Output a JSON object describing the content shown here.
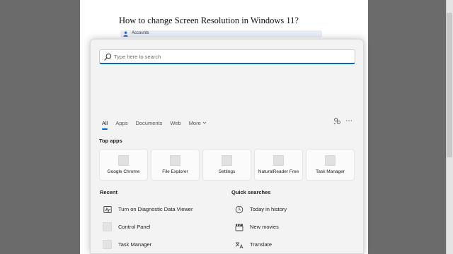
{
  "document": {
    "title": "How to change Screen Resolution in Windows 11?",
    "chip_label": "Accounts"
  },
  "search": {
    "placeholder": "Type here to search",
    "value": ""
  },
  "tabs": [
    {
      "label": "All",
      "active": true
    },
    {
      "label": "Apps"
    },
    {
      "label": "Documents"
    },
    {
      "label": "Web"
    },
    {
      "label": "More"
    }
  ],
  "header_icons": [
    "share-icon",
    "more-options-icon"
  ],
  "top_apps": {
    "title": "Top apps",
    "items": [
      {
        "label": "Google Chrome"
      },
      {
        "label": "File Explorer"
      },
      {
        "label": "Settings"
      },
      {
        "label": "NaturalReader Free"
      },
      {
        "label": "Task Manager"
      }
    ]
  },
  "recent": {
    "title": "Recent",
    "items": [
      {
        "label": "Turn on Diagnostic Data Viewer",
        "icon": "activity-chart-icon"
      },
      {
        "label": "Control Panel",
        "icon": "app-placeholder-icon"
      },
      {
        "label": "Task Manager",
        "icon": "app-placeholder-icon"
      }
    ]
  },
  "quick_searches": {
    "title": "Quick searches",
    "items": [
      {
        "label": "Today in history",
        "icon": "clock-icon"
      },
      {
        "label": "New movies",
        "icon": "clapperboard-icon"
      },
      {
        "label": "Translate",
        "icon": "translate-icon"
      }
    ]
  },
  "colors": {
    "accent": "#0067c0",
    "panel_bg": "#f3f3f3",
    "desktop_bg": "#6b6b6b"
  }
}
